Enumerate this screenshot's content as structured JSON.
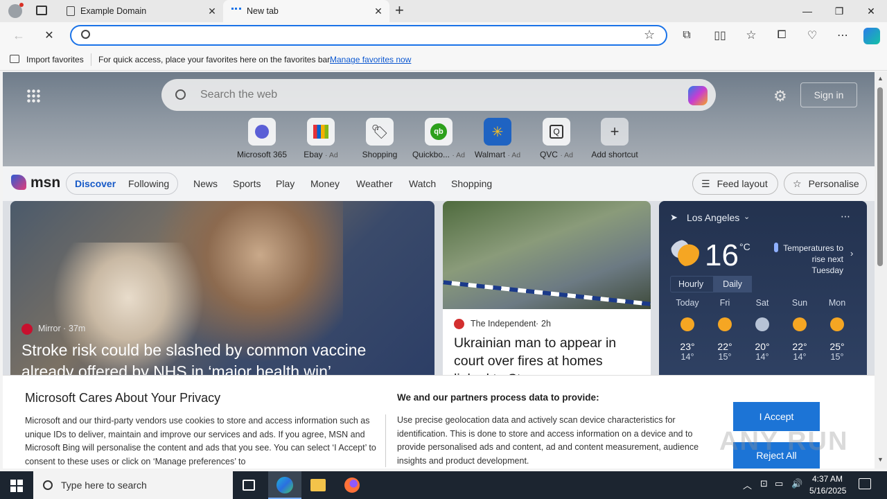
{
  "browser": {
    "tabs": [
      {
        "title": "Example Domain",
        "active": false
      },
      {
        "title": "New tab",
        "active": true
      }
    ],
    "favorites_bar": {
      "import_label": "Import favorites",
      "message": "For quick access, place your favorites here on the favorites bar.",
      "manage_link": "Manage favorites now"
    },
    "address_value": ""
  },
  "newtab": {
    "search_placeholder": "Search the web",
    "sign_in": "Sign in",
    "shortcuts": [
      {
        "label": "Microsoft 365",
        "ad": ""
      },
      {
        "label": "Ebay",
        "ad": "· Ad"
      },
      {
        "label": "Shopping",
        "ad": ""
      },
      {
        "label": "Quickbo...",
        "ad": "· Ad"
      },
      {
        "label": "Walmart",
        "ad": "· Ad"
      },
      {
        "label": "QVC",
        "ad": "· Ad"
      },
      {
        "label": "Add shortcut",
        "ad": ""
      }
    ],
    "msn": {
      "logo": "msn",
      "tabs": [
        "Discover",
        "Following"
      ],
      "nav": [
        "News",
        "Sports",
        "Play",
        "Money",
        "Weather",
        "Watch",
        "Shopping"
      ],
      "feed_layout": "Feed layout",
      "personalise": "Personalise"
    },
    "cards": {
      "main": {
        "source": "Mirror",
        "time": "37m",
        "headline": "Stroke risk could be slashed by common vaccine already offered by NHS in ‘major health win’"
      },
      "second": {
        "source": "The Independent",
        "time": "2h",
        "headline": "Ukrainian man to appear in court over fires at homes linked to Starmer"
      }
    },
    "weather": {
      "location": "Los Angeles",
      "temp": "16",
      "unit": "°C",
      "note": "Temperatures to rise next Tuesday",
      "modes": [
        "Hourly",
        "Daily"
      ],
      "days": [
        {
          "d": "Today",
          "hi": "23°",
          "lo": "14°"
        },
        {
          "d": "Fri",
          "hi": "22°",
          "lo": "15°"
        },
        {
          "d": "Sat",
          "hi": "20°",
          "lo": "14°"
        },
        {
          "d": "Sun",
          "hi": "22°",
          "lo": "14°"
        },
        {
          "d": "Mon",
          "hi": "25°",
          "lo": "15°"
        }
      ]
    }
  },
  "privacy": {
    "title": "Microsoft Cares About Your Privacy",
    "body": "Microsoft and our third-party vendors use cookies to store and access information such as unique IDs to deliver, maintain and improve our services and ads. If you agree, MSN and Microsoft Bing will personalise the content and ads that you see. You can select ‘I Accept’ to consent to these uses or click on ‘Manage preferences’ to",
    "title2": "We and our partners process data to provide:",
    "body2": "Use precise geolocation data and actively scan device characteristics for identification. This is done to store and access information on a device and to provide personalised ads and content, ad and content measurement, audience insights and product development.",
    "accept": "I Accept",
    "reject": "Reject All"
  },
  "taskbar": {
    "search_placeholder": "Type here to search",
    "time": "4:37 AM",
    "date": "5/16/2025"
  },
  "watermark": "ANY RUN"
}
